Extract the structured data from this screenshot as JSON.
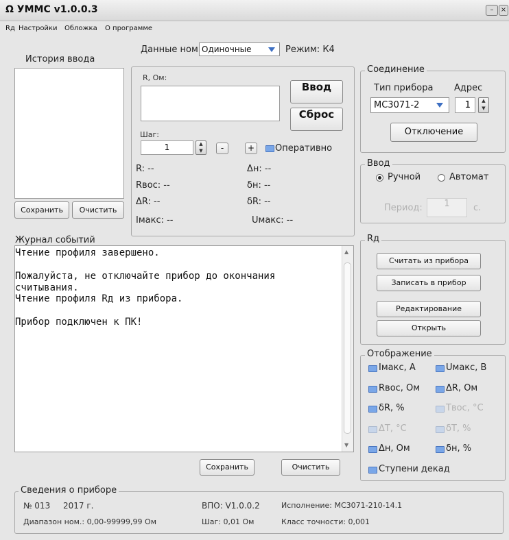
{
  "window": {
    "title": "УММС v1.0.0.3",
    "logo": "Ω",
    "minimize_glyph": "–",
    "close_glyph": "×"
  },
  "menu": [
    "Rд",
    "Настройки",
    "Обложка",
    "О программе"
  ],
  "top": {
    "data_label": "Данные ном:",
    "data_value": "Одиночные",
    "mode_label": "Режим: К4"
  },
  "history": {
    "legend": "История ввода",
    "save": "Сохранить",
    "clear": "Очистить"
  },
  "input": {
    "r_label": "R, Ом:",
    "enter": "Ввод",
    "reset": "Сброс",
    "step_label": "Шаг:",
    "step_value": "1",
    "minus": "-",
    "plus": "+",
    "operative": "Оперативно"
  },
  "readouts": {
    "r": "R: --",
    "dh": "Δн: --",
    "rvos": "Rвос: --",
    "delta_h": "δн: --",
    "dr": "ΔR: --",
    "delta_r": "δR: --",
    "imax": "Iмакс: --",
    "umax": "Uмакс: --"
  },
  "connection": {
    "legend": "Соединение",
    "type_label": "Тип прибора",
    "addr_label": "Адрес",
    "type_value": "МС3071-2",
    "addr_value": "1",
    "disconnect": "Отключение"
  },
  "vvod": {
    "legend": "Ввод",
    "manual": "Ручной",
    "auto": "Автомат",
    "period_label": "Период:",
    "period_value": "1",
    "period_unit": "с."
  },
  "log": {
    "legend": "Журнал событий",
    "lines": [
      "Чтение профиля завершено.",
      "",
      "Пожалуйста, не отключайте прибор до окончания",
      "считывания.",
      "Чтение профиля Rд из прибора.",
      "",
      "Прибор подключен к ПК!"
    ],
    "save": "Сохранить",
    "clear": "Очистить"
  },
  "rd": {
    "legend": "Rд",
    "read": "Считать из прибора",
    "write": "Записать в прибор",
    "edit": "Редактирование",
    "open": "Открыть"
  },
  "display": {
    "legend": "Отображение",
    "items": [
      "Iмакс, А",
      "Uмакс, В",
      "Rвос, Ом",
      "ΔR, Ом",
      "δR, %",
      "Твос, °С",
      "ΔТ, °С",
      "δТ, %",
      "Δн, Ом",
      "δн, %",
      "Ступени декад"
    ]
  },
  "device": {
    "legend": "Сведения о приборе",
    "number": "№ 013",
    "year": "2017 г.",
    "vpo": "ВПО: V1.0.0.2",
    "execution": "Исполнение: МС3071-210-14.1",
    "range": "Диапазон ном.: 0,00-99999,99 Ом",
    "step": "Шаг: 0,01 Ом",
    "accuracy": "Класс точности: 0,001"
  }
}
